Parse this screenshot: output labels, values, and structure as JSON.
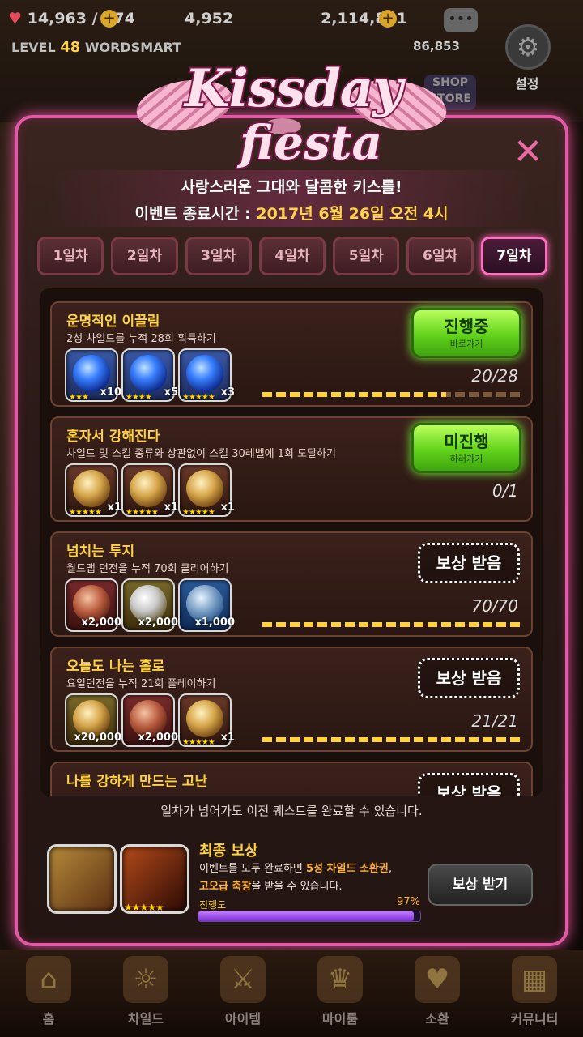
{
  "hud": {
    "hearts": "14,963 / 174",
    "gems": "4,952",
    "gold": "2,114,831",
    "level_prefix": "LEVEL",
    "level_num": "48",
    "user": "WORDSMART",
    "secondary_count": "86,853",
    "settings_label": "설정",
    "store_label": "SHOP STORE"
  },
  "event": {
    "logo_line1": "Kissday",
    "logo_line2": "fiesta",
    "subtitle": "사랑스러운 그대와 달콤한 키스를!",
    "end_prefix": "이벤트 종료시간 : ",
    "end_time": "2017년 6월 26일 오전 4시"
  },
  "tabs": [
    "1일차",
    "2일차",
    "3일차",
    "4일차",
    "5일차",
    "6일차",
    "7일차"
  ],
  "active_tab": "7일차",
  "quests": [
    {
      "title": "운명적인 이끌림",
      "desc": "2성 차일드를 누적 28회 획득하기",
      "rewards": [
        {
          "orb": "blue",
          "bg": "bg-blue",
          "count": "x10",
          "stars": "★★★"
        },
        {
          "orb": "blue",
          "bg": "bg-blue",
          "count": "x5",
          "stars": "★★★★"
        },
        {
          "orb": "blue",
          "bg": "bg-blue",
          "count": "x3",
          "stars": "★★★★★"
        }
      ],
      "button_type": "green",
      "button_main": "진행중",
      "button_sub": "바로가기",
      "progress": "20/28",
      "progress_value": 0.714
    },
    {
      "title": "혼자서 강해진다",
      "desc": "차일드 및 스킬 종류와 상관없이 스킬 30레벨에 1회 도달하기",
      "rewards": [
        {
          "orb": "gold",
          "bg": "bg-brown",
          "count": "x1",
          "stars": "★★★★★"
        },
        {
          "orb": "gold",
          "bg": "bg-brown",
          "count": "x1",
          "stars": "★★★★★"
        },
        {
          "orb": "gold",
          "bg": "bg-brown",
          "count": "x1",
          "stars": "★★★★★"
        }
      ],
      "button_type": "green",
      "button_main": "미진행",
      "button_sub": "하러가기",
      "progress": "0/1",
      "progress_value": 0
    },
    {
      "title": "넘치는 투지",
      "desc": "월드맵 던전을 누적 70회 클리어하기",
      "rewards": [
        {
          "orb": "copper",
          "bg": "bg-red",
          "count": "x2,000",
          "stars": ""
        },
        {
          "orb": "silver",
          "bg": "bg-gold",
          "count": "x2,000",
          "stars": ""
        },
        {
          "orb": "steel",
          "bg": "bg-steel",
          "count": "x1,000",
          "stars": ""
        }
      ],
      "button_type": "claim",
      "button_main": "보상 받음",
      "button_sub": "",
      "progress": "70/70",
      "progress_value": 1
    },
    {
      "title": "오늘도 나는 홀로",
      "desc": "요일던전을 누적 21회 플레이하기",
      "rewards": [
        {
          "orb": "gold",
          "bg": "bg-gold",
          "count": "x20,000",
          "stars": ""
        },
        {
          "orb": "copper",
          "bg": "bg-red",
          "count": "x2,000",
          "stars": ""
        },
        {
          "orb": "gold",
          "bg": "bg-brown",
          "count": "x1",
          "stars": "★★★★★"
        }
      ],
      "button_type": "claim",
      "button_main": "보상 받음",
      "button_sub": "",
      "progress": "21/21",
      "progress_value": 1
    },
    {
      "title": "나를 강하게 만드는 고난",
      "desc": "",
      "rewards": [],
      "button_type": "claim",
      "button_main": "보상 받음",
      "button_sub": "",
      "progress": "",
      "progress_value": 1
    }
  ],
  "note": "일차가 넘어가도 이전 퀘스트를 완료할 수 있습니다.",
  "final_reward": {
    "title": "최종 보상",
    "desc_pre": "이벤트를 모두 완료하면 ",
    "desc_hl1": "5성 차일드 소환권",
    "desc_mid": ",",
    "desc_hl2": "고오급 축창",
    "desc_post": "을 받을 수 있습니다.",
    "progress_label": "진행도",
    "progress_pct": "97%",
    "progress_value": 0.97,
    "button": "보상 받기"
  },
  "nav": [
    {
      "label": "홈",
      "icon": "home-icon"
    },
    {
      "label": "차일드",
      "icon": "child-icon"
    },
    {
      "label": "아이템",
      "icon": "item-icon"
    },
    {
      "label": "마이룸",
      "icon": "myroom-icon"
    },
    {
      "label": "소환",
      "icon": "summon-icon"
    },
    {
      "label": "커뮤니티",
      "icon": "community-icon"
    }
  ],
  "colors": {
    "accent": "#e25aa6",
    "highlight": "#ffd23e",
    "green": "#62d21c"
  }
}
